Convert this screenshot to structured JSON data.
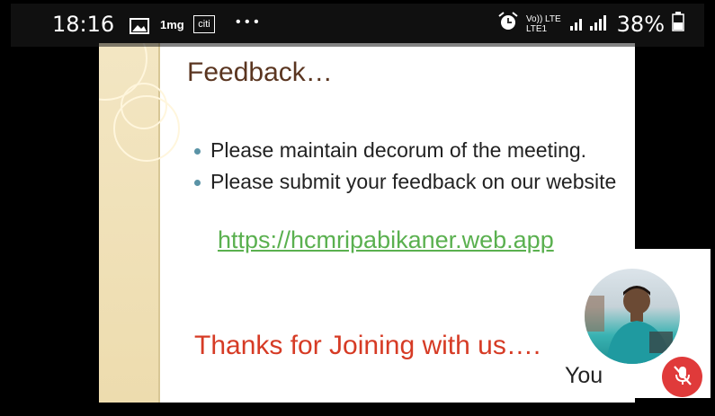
{
  "status_bar": {
    "time": "18:16",
    "icons": [
      "image-icon",
      "1mg-icon",
      "citi-icon",
      "more-icon"
    ],
    "notif_labels": [
      "1mg",
      "citi"
    ],
    "more": "• • •",
    "network_text": "Vo)) LTE",
    "network_sub": "LTE1",
    "battery": "38%"
  },
  "slide": {
    "title": "Feedback…",
    "bullets": [
      "Please maintain decorum of the meeting.",
      "Please submit your feedback on our website"
    ],
    "link": "https://hcmripabikaner.web.app",
    "thanks": "Thanks for Joining with us…."
  },
  "self_tile": {
    "label": "You",
    "mic_state": "muted"
  },
  "colors": {
    "title": "#5a3520",
    "link": "#5ab04f",
    "thanks": "#d63b25",
    "mic_off": "#e03a3a"
  }
}
